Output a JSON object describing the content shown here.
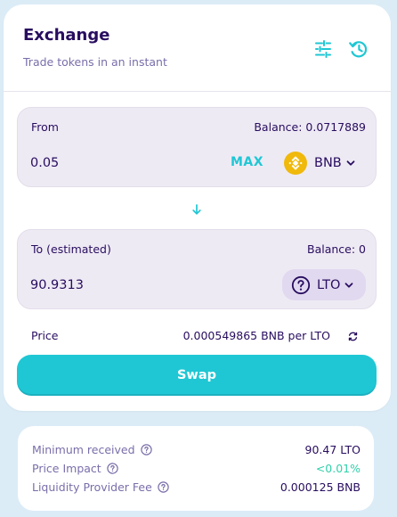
{
  "header": {
    "title": "Exchange",
    "subtitle": "Trade tokens in an instant",
    "icons": [
      "settings-sliders-icon",
      "history-clock-icon"
    ]
  },
  "from": {
    "label": "From",
    "balance": "Balance: 0.0717889",
    "amount": "0.05",
    "max_label": "MAX",
    "token": "BNB",
    "token_icon": "bnb-logo-icon"
  },
  "switch_icon": "arrow-down-icon",
  "to": {
    "label": "To (estimated)",
    "balance": "Balance: 0",
    "amount": "90.9313",
    "token": "LTO",
    "token_icon": "unknown-token-question-icon"
  },
  "price": {
    "label": "Price",
    "value": "0.000549865 BNB per LTO",
    "icon": "refresh-icon"
  },
  "swap_label": "Swap",
  "details": {
    "rows": [
      {
        "label": "Minimum received",
        "value": "90.47 LTO"
      },
      {
        "label": "Price Impact",
        "value": "<0.01%"
      },
      {
        "label": "Liquidity Provider Fee",
        "value": "0.000125 BNB"
      }
    ]
  },
  "colors": {
    "background": "#dcecf7",
    "primary": "#1fc7d4",
    "text": "#280d5f",
    "text_subtle": "#7a6eaa",
    "panel": "#eeeaf4",
    "success": "#31d0aa",
    "bnb": "#f0b90b"
  }
}
